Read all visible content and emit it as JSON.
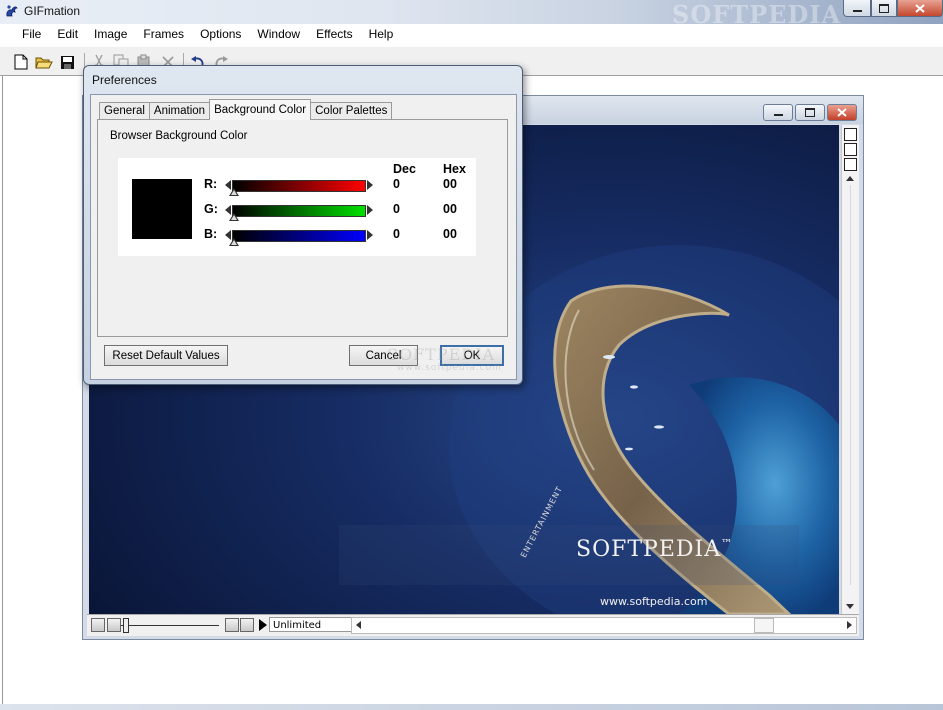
{
  "window": {
    "title": "GIFmation",
    "watermark": "SOFTPEDIA"
  },
  "menu": [
    "File",
    "Edit",
    "Image",
    "Frames",
    "Options",
    "Window",
    "Effects",
    "Help"
  ],
  "toolbar": {
    "icons": [
      "new-file-icon",
      "open-folder-icon",
      "save-disk-icon",
      "cut-icon",
      "copy-icon",
      "paste-icon",
      "delete-icon",
      "undo-icon",
      "redo-icon"
    ]
  },
  "image_window": {
    "loop_value": "Unlimited",
    "watermark_brand": "SOFTPEDIA",
    "watermark_trademark": "™",
    "watermark_url": "www.softpedia.com",
    "watermark_tagline": "ENTERTAINMENT"
  },
  "dialog": {
    "title": "Preferences",
    "tabs": [
      "General",
      "Animation",
      "Background Color",
      "Color Palettes"
    ],
    "active_tab": "Background Color",
    "group_label": "Browser Background Color",
    "col_dec": "Dec",
    "col_hex": "Hex",
    "swatch_color": "#000000",
    "channels": [
      {
        "label": "R:",
        "dec": "0",
        "hex": "00",
        "color": "#ff0000"
      },
      {
        "label": "G:",
        "dec": "0",
        "hex": "00",
        "color": "#00e000"
      },
      {
        "label": "B:",
        "dec": "0",
        "hex": "00",
        "color": "#0000ff"
      }
    ],
    "reset_label": "Reset Default Values",
    "cancel_label": "Cancel",
    "ok_label": "OK",
    "overlay_watermark": "SOFTPEDIA",
    "overlay_url": "www.softpedia.com"
  }
}
